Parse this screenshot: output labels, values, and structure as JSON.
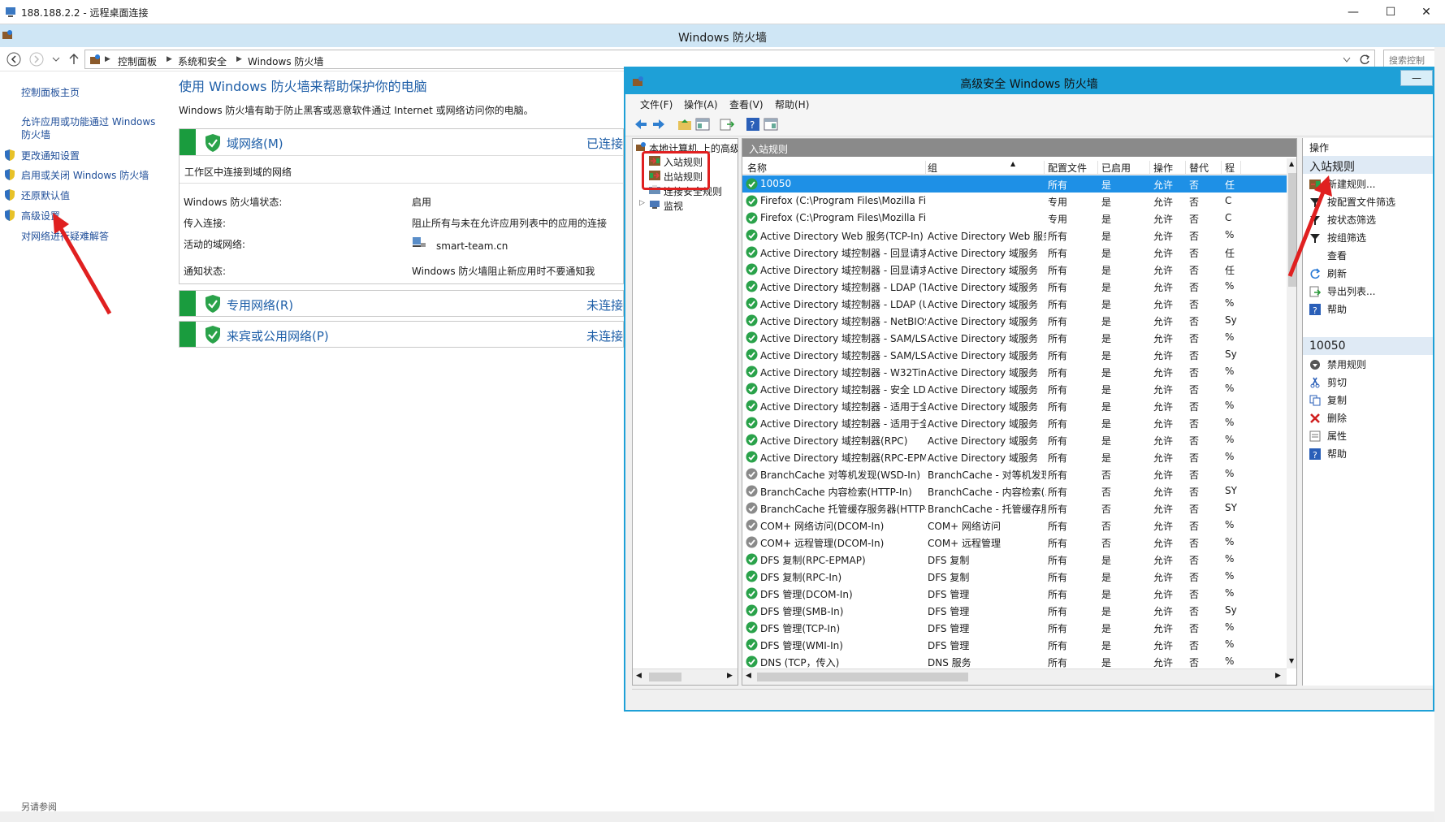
{
  "rdp": {
    "title": "188.188.2.2 - 远程桌面连接",
    "min": "—",
    "max": "☐",
    "close": "✕"
  },
  "cp": {
    "window_title": "Windows 防火墙",
    "breadcrumb": [
      "控制面板",
      "系统和安全",
      "Windows 防火墙"
    ],
    "search_placeholder": "搜索控制",
    "nav": {
      "home": "控制面板主页",
      "allow_apps": "允许应用或功能通过 Windows 防火墙",
      "notify": "更改通知设置",
      "toggle": "启用或关闭 Windows 防火墙",
      "restore": "还原默认值",
      "advanced": "高级设置",
      "troubleshoot": "对网络进行疑难解答",
      "see_also": "另请参阅"
    },
    "heading": "使用 Windows 防火墙来帮助保护你的电脑",
    "description": "Windows 防火墙有助于防止黑客或恶意软件通过 Internet 或网络访问你的电脑。",
    "domain": {
      "title": "域网络(M)",
      "status": "已连接",
      "subtitle": "工作区中连接到域的网络",
      "labels": [
        "Windows 防火墙状态:",
        "传入连接:",
        "活动的域网络:",
        "通知状态:"
      ],
      "values": [
        "启用",
        "阻止所有与未在允许应用列表中的应用的连接",
        "smart-team.cn",
        "Windows 防火墙阻止新应用时不要通知我"
      ]
    },
    "private": {
      "title": "专用网络(R)",
      "status": "未连接"
    },
    "public": {
      "title": "来宾或公用网络(P)",
      "status": "未连接"
    }
  },
  "mmc": {
    "title": "高级安全 Windows 防火墙",
    "menu": [
      "文件(F)",
      "操作(A)",
      "查看(V)",
      "帮助(H)"
    ],
    "tree": {
      "root": "本地计算机 上的高级",
      "inbound": "入站规则",
      "outbound": "出站规则",
      "connsec": "连接安全规则",
      "monitor": "监视"
    },
    "list_title": "入站规则",
    "columns": [
      "名称",
      "组",
      "配置文件",
      "已启用",
      "操作",
      "替代",
      "程"
    ],
    "rows": [
      {
        "name": "10050",
        "group": "",
        "profile": "所有",
        "enabled": "是",
        "action": "允许",
        "override": "否",
        "prog": "任",
        "on": true,
        "sel": true
      },
      {
        "name": "Firefox (C:\\Program Files\\Mozilla Fire...",
        "group": "",
        "profile": "专用",
        "enabled": "是",
        "action": "允许",
        "override": "否",
        "prog": "C",
        "on": true
      },
      {
        "name": "Firefox (C:\\Program Files\\Mozilla Fire...",
        "group": "",
        "profile": "专用",
        "enabled": "是",
        "action": "允许",
        "override": "否",
        "prog": "C",
        "on": true
      },
      {
        "name": "Active Directory Web 服务(TCP-In)",
        "group": "Active Directory Web 服务",
        "profile": "所有",
        "enabled": "是",
        "action": "允许",
        "override": "否",
        "prog": "%",
        "on": true
      },
      {
        "name": "Active Directory 域控制器 - 回显请求(I...",
        "group": "Active Directory 域服务",
        "profile": "所有",
        "enabled": "是",
        "action": "允许",
        "override": "否",
        "prog": "任",
        "on": true
      },
      {
        "name": "Active Directory 域控制器 - 回显请求(I...",
        "group": "Active Directory 域服务",
        "profile": "所有",
        "enabled": "是",
        "action": "允许",
        "override": "否",
        "prog": "任",
        "on": true
      },
      {
        "name": "Active Directory 域控制器 - LDAP (TCP...",
        "group": "Active Directory 域服务",
        "profile": "所有",
        "enabled": "是",
        "action": "允许",
        "override": "否",
        "prog": "%",
        "on": true
      },
      {
        "name": "Active Directory 域控制器 - LDAP (UD...",
        "group": "Active Directory 域服务",
        "profile": "所有",
        "enabled": "是",
        "action": "允许",
        "override": "否",
        "prog": "%",
        "on": true
      },
      {
        "name": "Active Directory 域控制器 - NetBIOS ...",
        "group": "Active Directory 域服务",
        "profile": "所有",
        "enabled": "是",
        "action": "允许",
        "override": "否",
        "prog": "Sy",
        "on": true
      },
      {
        "name": "Active Directory 域控制器 - SAM/LSA (...",
        "group": "Active Directory 域服务",
        "profile": "所有",
        "enabled": "是",
        "action": "允许",
        "override": "否",
        "prog": "%",
        "on": true
      },
      {
        "name": "Active Directory 域控制器 - SAM/LSA (...",
        "group": "Active Directory 域服务",
        "profile": "所有",
        "enabled": "是",
        "action": "允许",
        "override": "否",
        "prog": "Sy",
        "on": true
      },
      {
        "name": "Active Directory 域控制器 - W32Time ...",
        "group": "Active Directory 域服务",
        "profile": "所有",
        "enabled": "是",
        "action": "允许",
        "override": "否",
        "prog": "%",
        "on": true
      },
      {
        "name": "Active Directory 域控制器 - 安全 LDAP...",
        "group": "Active Directory 域服务",
        "profile": "所有",
        "enabled": "是",
        "action": "允许",
        "override": "否",
        "prog": "%",
        "on": true
      },
      {
        "name": "Active Directory 域控制器 - 适用于全局...",
        "group": "Active Directory 域服务",
        "profile": "所有",
        "enabled": "是",
        "action": "允许",
        "override": "否",
        "prog": "%",
        "on": true
      },
      {
        "name": "Active Directory 域控制器 - 适用于全局...",
        "group": "Active Directory 域服务",
        "profile": "所有",
        "enabled": "是",
        "action": "允许",
        "override": "否",
        "prog": "%",
        "on": true
      },
      {
        "name": "Active Directory 域控制器(RPC)",
        "group": "Active Directory 域服务",
        "profile": "所有",
        "enabled": "是",
        "action": "允许",
        "override": "否",
        "prog": "%",
        "on": true
      },
      {
        "name": "Active Directory 域控制器(RPC-EPMAP)",
        "group": "Active Directory 域服务",
        "profile": "所有",
        "enabled": "是",
        "action": "允许",
        "override": "否",
        "prog": "%",
        "on": true
      },
      {
        "name": "BranchCache 对等机发现(WSD-In)",
        "group": "BranchCache - 对等机发现...",
        "profile": "所有",
        "enabled": "否",
        "action": "允许",
        "override": "否",
        "prog": "%",
        "on": false
      },
      {
        "name": "BranchCache 内容检索(HTTP-In)",
        "group": "BranchCache - 内容检索(...",
        "profile": "所有",
        "enabled": "否",
        "action": "允许",
        "override": "否",
        "prog": "SY",
        "on": false
      },
      {
        "name": "BranchCache 托管缓存服务器(HTTP-In)",
        "group": "BranchCache - 托管缓存服...",
        "profile": "所有",
        "enabled": "否",
        "action": "允许",
        "override": "否",
        "prog": "SY",
        "on": false
      },
      {
        "name": "COM+ 网络访问(DCOM-In)",
        "group": "COM+ 网络访问",
        "profile": "所有",
        "enabled": "否",
        "action": "允许",
        "override": "否",
        "prog": "%",
        "on": false
      },
      {
        "name": "COM+ 远程管理(DCOM-In)",
        "group": "COM+ 远程管理",
        "profile": "所有",
        "enabled": "否",
        "action": "允许",
        "override": "否",
        "prog": "%",
        "on": false
      },
      {
        "name": "DFS 复制(RPC-EPMAP)",
        "group": "DFS 复制",
        "profile": "所有",
        "enabled": "是",
        "action": "允许",
        "override": "否",
        "prog": "%",
        "on": true
      },
      {
        "name": "DFS 复制(RPC-In)",
        "group": "DFS 复制",
        "profile": "所有",
        "enabled": "是",
        "action": "允许",
        "override": "否",
        "prog": "%",
        "on": true
      },
      {
        "name": "DFS 管理(DCOM-In)",
        "group": "DFS 管理",
        "profile": "所有",
        "enabled": "是",
        "action": "允许",
        "override": "否",
        "prog": "%",
        "on": true
      },
      {
        "name": "DFS 管理(SMB-In)",
        "group": "DFS 管理",
        "profile": "所有",
        "enabled": "是",
        "action": "允许",
        "override": "否",
        "prog": "Sy",
        "on": true
      },
      {
        "name": "DFS 管理(TCP-In)",
        "group": "DFS 管理",
        "profile": "所有",
        "enabled": "是",
        "action": "允许",
        "override": "否",
        "prog": "%",
        "on": true
      },
      {
        "name": "DFS 管理(WMI-In)",
        "group": "DFS 管理",
        "profile": "所有",
        "enabled": "是",
        "action": "允许",
        "override": "否",
        "prog": "%",
        "on": true
      },
      {
        "name": "DNS (TCP，传入)",
        "group": "DNS 服务",
        "profile": "所有",
        "enabled": "是",
        "action": "允许",
        "override": "否",
        "prog": "%",
        "on": true
      }
    ],
    "actions_title": "操作",
    "section1": "入站规则",
    "section1_items": [
      "新建规则...",
      "按配置文件筛选",
      "按状态筛选",
      "按组筛选",
      "查看",
      "刷新",
      "导出列表...",
      "帮助"
    ],
    "section2": "10050",
    "section2_items": [
      "禁用规则",
      "剪切",
      "复制",
      "删除",
      "属性",
      "帮助"
    ]
  },
  "colors": {
    "accent": "#1ea0d7",
    "link": "#1f4e99",
    "green": "#1a9c3e",
    "highlight_red": "#e02020",
    "selection": "#1e90e6"
  }
}
